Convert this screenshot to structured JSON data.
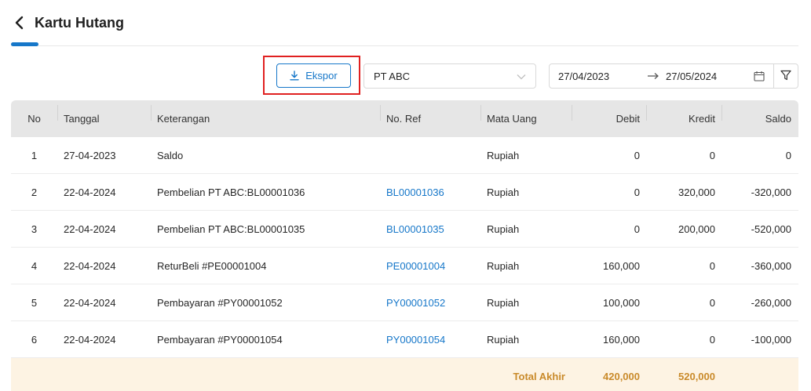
{
  "header": {
    "title": "Kartu Hutang"
  },
  "toolbar": {
    "export_label": "Ekspor",
    "supplier_value": "PT ABC",
    "date_start": "27/04/2023",
    "date_end": "27/05/2024"
  },
  "table": {
    "columns": [
      "No",
      "Tanggal",
      "Keterangan",
      "No. Ref",
      "Mata Uang",
      "Debit",
      "Kredit",
      "Saldo"
    ],
    "rows": [
      {
        "no": "1",
        "tanggal": "27-04-2023",
        "keterangan": "Saldo",
        "ref": "",
        "mata_uang": "Rupiah",
        "debit": "0",
        "kredit": "0",
        "saldo": "0"
      },
      {
        "no": "2",
        "tanggal": "22-04-2024",
        "keterangan": "Pembelian PT ABC:BL00001036",
        "ref": "BL00001036",
        "mata_uang": "Rupiah",
        "debit": "0",
        "kredit": "320,000",
        "saldo": "-320,000"
      },
      {
        "no": "3",
        "tanggal": "22-04-2024",
        "keterangan": "Pembelian PT ABC:BL00001035",
        "ref": "BL00001035",
        "mata_uang": "Rupiah",
        "debit": "0",
        "kredit": "200,000",
        "saldo": "-520,000"
      },
      {
        "no": "4",
        "tanggal": "22-04-2024",
        "keterangan": "ReturBeli #PE00001004",
        "ref": "PE00001004",
        "mata_uang": "Rupiah",
        "debit": "160,000",
        "kredit": "0",
        "saldo": "-360,000"
      },
      {
        "no": "5",
        "tanggal": "22-04-2024",
        "keterangan": "Pembayaran #PY00001052",
        "ref": "PY00001052",
        "mata_uang": "Rupiah",
        "debit": "100,000",
        "kredit": "0",
        "saldo": "-260,000"
      },
      {
        "no": "6",
        "tanggal": "22-04-2024",
        "keterangan": "Pembayaran #PY00001054",
        "ref": "PY00001054",
        "mata_uang": "Rupiah",
        "debit": "160,000",
        "kredit": "0",
        "saldo": "-100,000"
      }
    ],
    "footer": {
      "label": "Total Akhir",
      "debit": "420,000",
      "kredit": "520,000"
    }
  },
  "colors": {
    "accent": "#1677c9",
    "highlight": "#e02020",
    "footer_bg": "#fdf3e3",
    "footer_text": "#c98a2a"
  }
}
